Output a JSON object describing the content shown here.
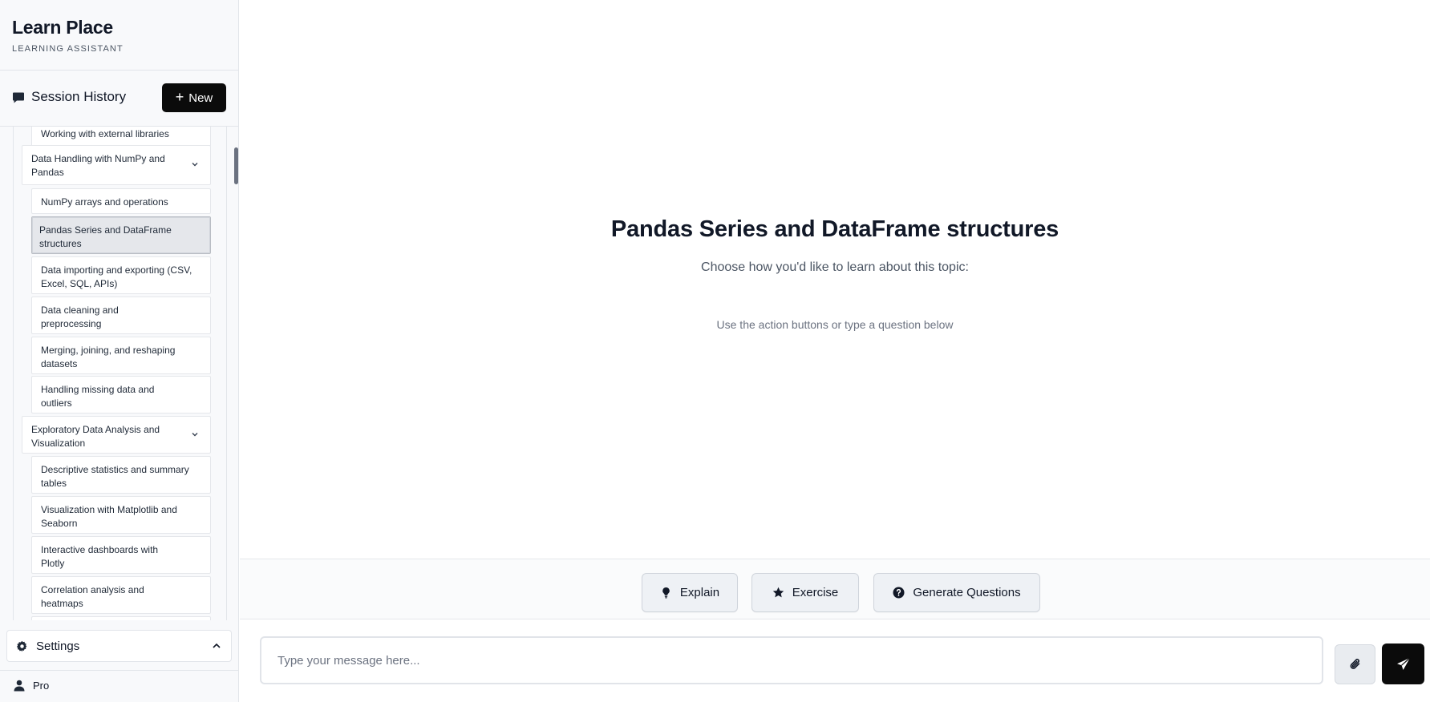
{
  "brand": {
    "title": "Learn Place",
    "subtitle": "LEARNING ASSISTANT"
  },
  "history": {
    "title": "Session History",
    "new_label": "New"
  },
  "tree": {
    "items": [
      {
        "label": "Working with external libraries"
      },
      {
        "label": "Data Handling with NumPy and Pandas"
      },
      {
        "label": "NumPy arrays and operations"
      },
      {
        "label": "Pandas Series and DataFrame structures",
        "active": true
      },
      {
        "label": "Data importing and exporting (CSV, Excel, SQL, APIs)"
      },
      {
        "label": "Data cleaning and preprocessing"
      },
      {
        "label": "Merging, joining, and reshaping datasets"
      },
      {
        "label": "Handling missing data and outliers"
      },
      {
        "label": "Exploratory Data Analysis and Visualization"
      },
      {
        "label": "Descriptive statistics and summary tables"
      },
      {
        "label": "Visualization with Matplotlib and Seaborn"
      },
      {
        "label": "Interactive dashboards with Plotly"
      },
      {
        "label": "Correlation analysis and heatmaps"
      }
    ]
  },
  "settings": {
    "label": "Settings"
  },
  "user": {
    "plan": "Pro"
  },
  "main": {
    "title": "Pandas Series and DataFrame structures",
    "subtitle": "Choose how you'd like to learn about this topic:",
    "hint": "Use the action buttons or type a question below"
  },
  "actions": {
    "explain": "Explain",
    "exercise": "Exercise",
    "generate": "Generate Questions"
  },
  "composer": {
    "placeholder": "Type your message here..."
  },
  "icons": {
    "history": "chat-bubble-icon",
    "settings": "gear-icon",
    "user": "user-icon",
    "explain": "lightbulb-icon",
    "exercise": "star-icon",
    "generate": "question-circle-icon",
    "attach": "paperclip-icon",
    "send": "paper-plane-icon"
  },
  "colors": {
    "accent": "#0b0b0b",
    "active_item": "#e5e7eb",
    "sidebar_bg": "#f8f9fb"
  }
}
